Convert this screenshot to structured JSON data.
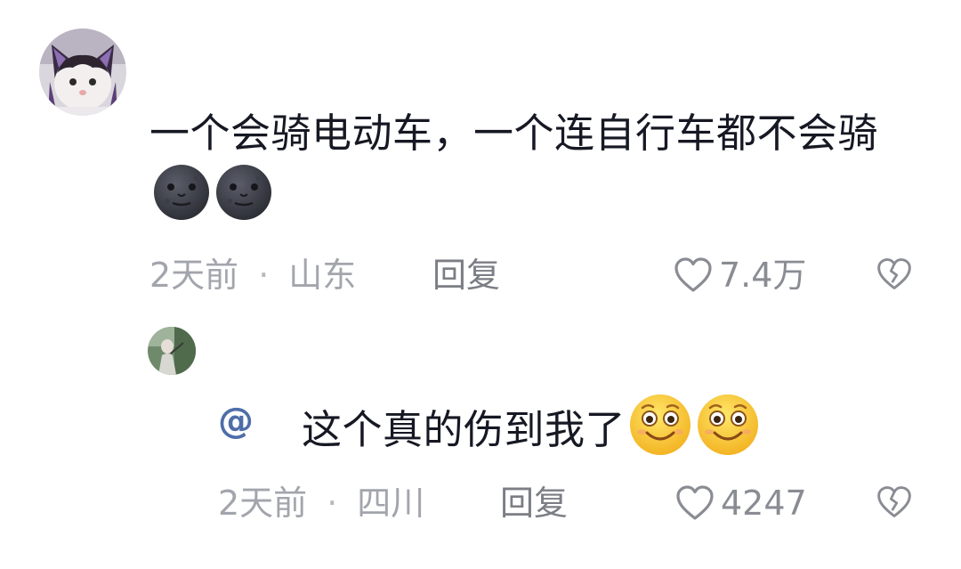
{
  "comment": {
    "text": "一个会骑电动车，一个连自行车都不会骑",
    "emojis": [
      "new-moon-face-emoji",
      "new-moon-face-emoji"
    ],
    "time": "2天前",
    "separator": "·",
    "location": "山东",
    "reply_label": "回复",
    "like_count": "7.4万"
  },
  "reply": {
    "mention_symbol": "@",
    "text": "这个真的伤到我了",
    "emojis": [
      "smiling-face-emoji",
      "smiling-face-emoji"
    ],
    "time": "2天前",
    "separator": "·",
    "location": "四川",
    "reply_label": "回复",
    "like_count": "4247"
  },
  "colors": {
    "text_primary": "#161823",
    "text_meta": "#a3a5ad",
    "mention": "#4e6ea9",
    "background": "#ffffff"
  }
}
